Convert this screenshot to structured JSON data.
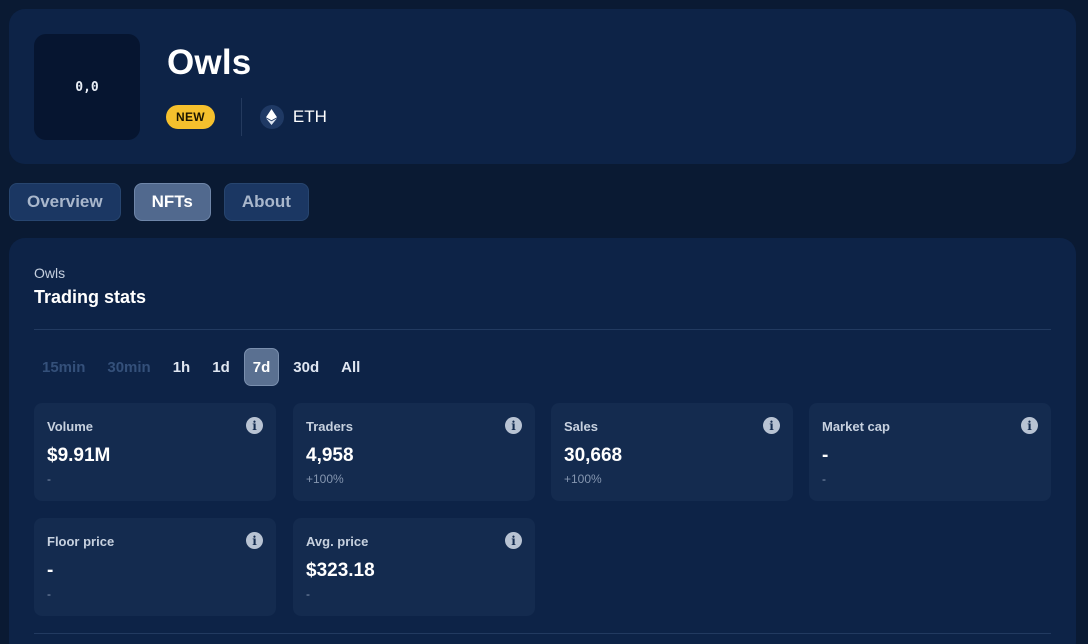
{
  "header": {
    "avatar_text": "0,0",
    "title": "Owls",
    "badge": "NEW",
    "chain": "ETH",
    "chain_icon": "ethereum-icon"
  },
  "tabs": [
    {
      "label": "Overview",
      "active": false
    },
    {
      "label": "NFTs",
      "active": true
    },
    {
      "label": "About",
      "active": false
    }
  ],
  "panel": {
    "subtitle": "Owls",
    "title": "Trading stats",
    "ranges": [
      {
        "label": "15min",
        "state": "disabled"
      },
      {
        "label": "30min",
        "state": "disabled"
      },
      {
        "label": "1h",
        "state": "normal"
      },
      {
        "label": "1d",
        "state": "normal"
      },
      {
        "label": "7d",
        "state": "active"
      },
      {
        "label": "30d",
        "state": "normal"
      },
      {
        "label": "All",
        "state": "normal"
      }
    ],
    "stats": [
      {
        "label": "Volume",
        "value": "$9.91M",
        "change": "-"
      },
      {
        "label": "Traders",
        "value": "4,958",
        "change": "+100%"
      },
      {
        "label": "Sales",
        "value": "30,668",
        "change": "+100%"
      },
      {
        "label": "Market cap",
        "value": "-",
        "change": "-"
      },
      {
        "label": "Floor price",
        "value": "-",
        "change": "-"
      },
      {
        "label": "Avg. price",
        "value": "$323.18",
        "change": "-"
      }
    ],
    "info_icon": "info-icon"
  },
  "colors": {
    "background": "#0a1a33",
    "card": "#0d2347",
    "badge": "#f5c02d",
    "active_tab": "#51698e"
  }
}
